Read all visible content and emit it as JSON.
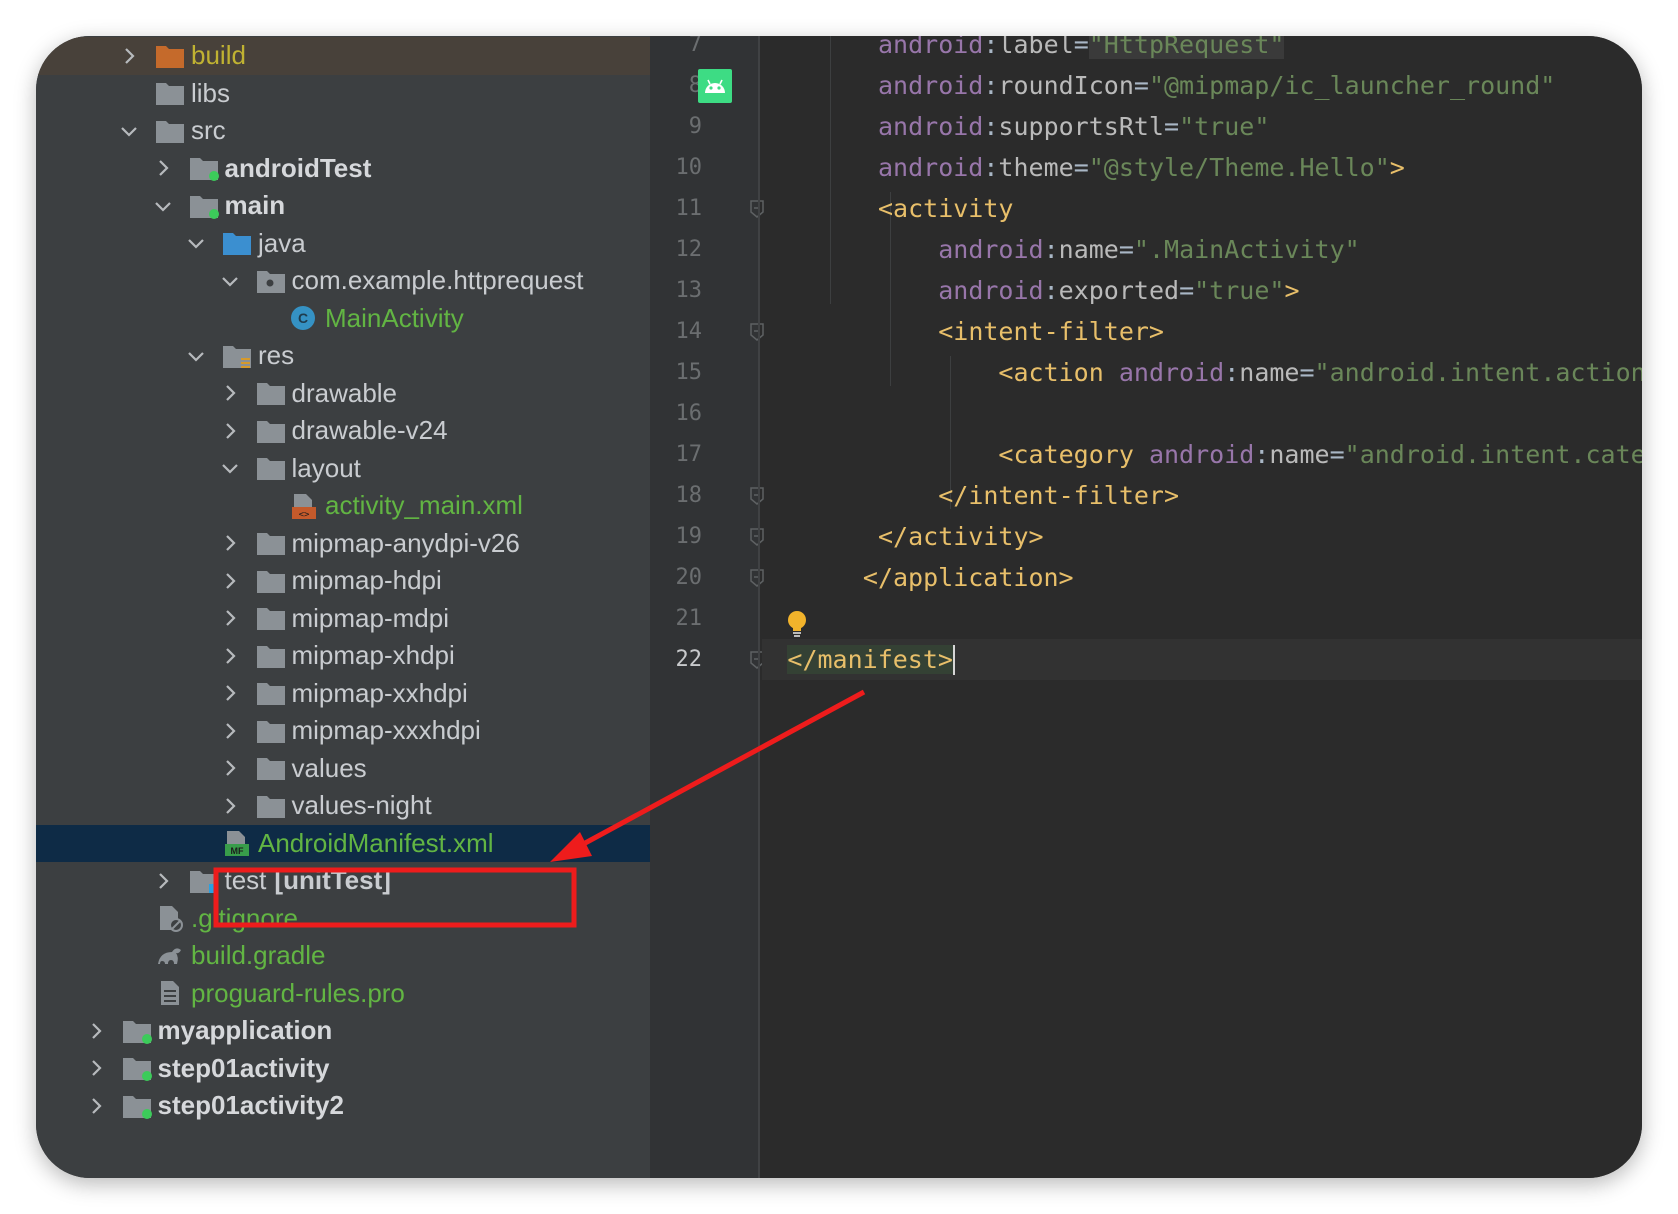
{
  "project_tree": [
    {
      "label": "build",
      "chevron": "right",
      "icon": "folder-orange-icon",
      "style": "orange",
      "excluded": true,
      "indent": 2
    },
    {
      "label": "libs",
      "chevron": "none",
      "icon": "folder-icon",
      "style": "normal",
      "indent": 2
    },
    {
      "label": "src",
      "chevron": "down",
      "icon": "folder-icon",
      "style": "normal",
      "indent": 2
    },
    {
      "label": "androidTest",
      "chevron": "right",
      "icon": "module-folder-icon",
      "style": "bold",
      "indent": 3
    },
    {
      "label": "main",
      "chevron": "down",
      "icon": "module-folder-icon",
      "style": "bold",
      "indent": 3
    },
    {
      "label": "java",
      "chevron": "down",
      "icon": "source-folder-icon",
      "style": "normal",
      "indent": 4
    },
    {
      "label": "com.example.httprequest",
      "chevron": "down",
      "icon": "package-icon",
      "style": "normal",
      "indent": 5
    },
    {
      "label": "MainActivity",
      "chevron": "none",
      "icon": "class-icon",
      "style": "green",
      "indent": 6
    },
    {
      "label": "res",
      "chevron": "down",
      "icon": "resource-folder-icon",
      "style": "normal",
      "indent": 4
    },
    {
      "label": "drawable",
      "chevron": "right",
      "icon": "folder-icon",
      "style": "normal",
      "indent": 5
    },
    {
      "label": "drawable-v24",
      "chevron": "right",
      "icon": "folder-icon",
      "style": "normal",
      "indent": 5
    },
    {
      "label": "layout",
      "chevron": "down",
      "icon": "folder-icon",
      "style": "normal",
      "indent": 5
    },
    {
      "label": "activity_main.xml",
      "chevron": "none",
      "icon": "xml-file-icon",
      "style": "green",
      "indent": 6
    },
    {
      "label": "mipmap-anydpi-v26",
      "chevron": "right",
      "icon": "folder-icon",
      "style": "normal",
      "indent": 5
    },
    {
      "label": "mipmap-hdpi",
      "chevron": "right",
      "icon": "folder-icon",
      "style": "normal",
      "indent": 5
    },
    {
      "label": "mipmap-mdpi",
      "chevron": "right",
      "icon": "folder-icon",
      "style": "normal",
      "indent": 5
    },
    {
      "label": "mipmap-xhdpi",
      "chevron": "right",
      "icon": "folder-icon",
      "style": "normal",
      "indent": 5
    },
    {
      "label": "mipmap-xxhdpi",
      "chevron": "right",
      "icon": "folder-icon",
      "style": "normal",
      "indent": 5
    },
    {
      "label": "mipmap-xxxhdpi",
      "chevron": "right",
      "icon": "folder-icon",
      "style": "normal",
      "indent": 5
    },
    {
      "label": "values",
      "chevron": "right",
      "icon": "folder-icon",
      "style": "normal",
      "indent": 5
    },
    {
      "label": "values-night",
      "chevron": "right",
      "icon": "folder-icon",
      "style": "normal",
      "indent": 5
    },
    {
      "label": "AndroidManifest.xml",
      "chevron": "none",
      "icon": "manifest-file-icon",
      "style": "green",
      "selected": true,
      "indent": 4
    },
    {
      "label": "test",
      "suffix": "[unitTest]",
      "chevron": "right",
      "icon": "test-folder-icon",
      "style": "normal",
      "indent": 3
    },
    {
      "label": ".gitignore",
      "chevron": "none",
      "icon": "gitignore-file-icon",
      "style": "green",
      "indent": 2
    },
    {
      "label": "build.gradle",
      "chevron": "none",
      "icon": "gradle-file-icon",
      "style": "green",
      "indent": 2
    },
    {
      "label": "proguard-rules.pro",
      "chevron": "none",
      "icon": "text-file-icon",
      "style": "green",
      "indent": 2
    },
    {
      "label": "myapplication",
      "chevron": "right",
      "icon": "module-folder-icon",
      "style": "bold",
      "indent": 1
    },
    {
      "label": "step01activity",
      "chevron": "right",
      "icon": "module-folder-icon",
      "style": "bold",
      "indent": 1
    },
    {
      "label": "step01activity2",
      "chevron": "right",
      "icon": "module-folder-icon",
      "style": "bold",
      "indent": 1
    }
  ],
  "editor": {
    "line_numbers": [
      "7",
      "8",
      "9",
      "10",
      "11",
      "12",
      "13",
      "14",
      "15",
      "16",
      "17",
      "18",
      "19",
      "20",
      "21",
      "22"
    ],
    "current_line": "22",
    "lines": [
      [
        [
          "attr",
          "android"
        ],
        [
          "eq",
          ":"
        ],
        [
          "name",
          "label"
        ],
        [
          "eq",
          "="
        ],
        [
          "strhl",
          "\"HttpRequest\""
        ]
      ],
      [
        [
          "attr",
          "android"
        ],
        [
          "eq",
          ":"
        ],
        [
          "name",
          "roundIcon"
        ],
        [
          "eq",
          "="
        ],
        [
          "str",
          "\"@mipmap/ic_launcher_round\""
        ]
      ],
      [
        [
          "attr",
          "android"
        ],
        [
          "eq",
          ":"
        ],
        [
          "name",
          "supportsRtl"
        ],
        [
          "eq",
          "="
        ],
        [
          "str",
          "\"true\""
        ]
      ],
      [
        [
          "attr",
          "android"
        ],
        [
          "eq",
          ":"
        ],
        [
          "name",
          "theme"
        ],
        [
          "eq",
          "="
        ],
        [
          "str",
          "\"@style/Theme.Hello\""
        ],
        [
          "tag",
          ">"
        ]
      ],
      [
        [
          "tag",
          "<activity"
        ]
      ],
      [
        [
          "pad",
          "    "
        ],
        [
          "attr",
          "android"
        ],
        [
          "eq",
          ":"
        ],
        [
          "name",
          "name"
        ],
        [
          "eq",
          "="
        ],
        [
          "str",
          "\".MainActivity\""
        ]
      ],
      [
        [
          "pad",
          "    "
        ],
        [
          "attr",
          "android"
        ],
        [
          "eq",
          ":"
        ],
        [
          "name",
          "exported"
        ],
        [
          "eq",
          "="
        ],
        [
          "str",
          "\"true\""
        ],
        [
          "tag",
          ">"
        ]
      ],
      [
        [
          "pad",
          "    "
        ],
        [
          "tag",
          "<intent-filter>"
        ]
      ],
      [
        [
          "pad",
          "        "
        ],
        [
          "tag",
          "<action "
        ],
        [
          "attr",
          "android"
        ],
        [
          "eq",
          ":"
        ],
        [
          "name",
          "name"
        ],
        [
          "eq",
          "="
        ],
        [
          "str",
          "\"android.intent.action.MAIN\""
        ],
        [
          "tag",
          " />"
        ]
      ],
      [],
      [
        [
          "pad",
          "        "
        ],
        [
          "tag",
          "<category "
        ],
        [
          "attr",
          "android"
        ],
        [
          "eq",
          ":"
        ],
        [
          "name",
          "name"
        ],
        [
          "eq",
          "="
        ],
        [
          "str",
          "\"android.intent.category.LAUNCHER\""
        ],
        [
          "tag",
          " />"
        ]
      ],
      [
        [
          "pad",
          "    "
        ],
        [
          "tag",
          "</intent-filter>"
        ]
      ],
      [
        [
          "tag",
          "</activity>"
        ]
      ],
      [
        [
          "tag",
          "</application>"
        ]
      ],
      [],
      [
        [
          "taghl",
          "</manifest>"
        ]
      ]
    ],
    "line_indent_cols": [
      0,
      0,
      0,
      0,
      0,
      0,
      0,
      0,
      0,
      0,
      0,
      0,
      0,
      -1,
      0,
      -6
    ]
  },
  "annotation": {
    "color": "#ee1c1c",
    "label": "AndroidManifest.xml highlight"
  }
}
